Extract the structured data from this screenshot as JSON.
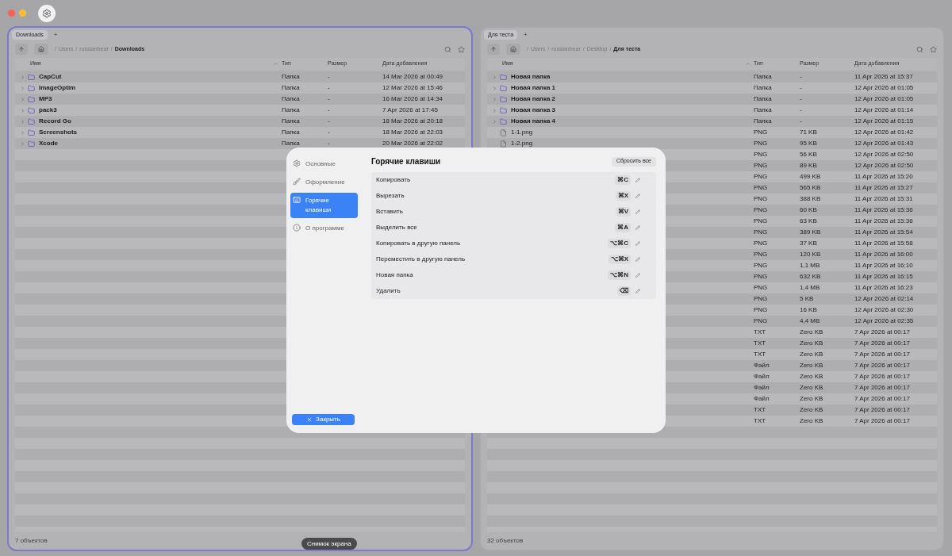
{
  "window": {
    "lights": [
      {
        "color": "#ff5f57"
      },
      {
        "color": "#febc2e"
      }
    ]
  },
  "panels": [
    {
      "active": true,
      "tabs": [
        {
          "label": "Downloads",
          "selected": true
        }
      ],
      "add_tab": "+",
      "separator": "/",
      "path": [
        "/",
        "Users",
        "russianbear",
        "Downloads"
      ],
      "columns": [
        "Имя",
        "Тип",
        "Размер",
        "Дата добавления"
      ],
      "rows": [
        {
          "kind": "folder",
          "name": "CapCut",
          "type": "Папка",
          "size": "-",
          "date": "14 Mar 2026 at 00:49"
        },
        {
          "kind": "folder",
          "name": "ImageOptim",
          "type": "Папка",
          "size": "-",
          "date": "12 Mar 2026 at 15:46"
        },
        {
          "kind": "folder",
          "name": "MP3",
          "type": "Папка",
          "size": "-",
          "date": "16 Mar 2026 at 14:34"
        },
        {
          "kind": "folder",
          "name": "pack3",
          "type": "Папка",
          "size": "-",
          "date": "7 Apr 2026 at 17:45"
        },
        {
          "kind": "folder",
          "name": "Record Go",
          "type": "Папка",
          "size": "-",
          "date": "18 Mar 2026 at 20:18"
        },
        {
          "kind": "folder",
          "name": "Screenshots",
          "type": "Папка",
          "size": "-",
          "date": "18 Mar 2026 at 22:03"
        },
        {
          "kind": "folder",
          "name": "Xcode",
          "type": "Папка",
          "size": "-",
          "date": "20 Mar 2026 at 22:02"
        }
      ],
      "status": "7 объектов"
    },
    {
      "active": false,
      "tabs": [
        {
          "label": "Для теста",
          "selected": true
        }
      ],
      "add_tab": "+",
      "separator": "/",
      "path": [
        "/",
        "Users",
        "russianbear",
        "Desktop",
        "Для теста"
      ],
      "columns": [
        "Имя",
        "Тип",
        "Размер",
        "Дата добавления"
      ],
      "rows": [
        {
          "kind": "folder",
          "name": "Новая папка",
          "type": "Папка",
          "size": "-",
          "date": "11 Apr 2026 at 15:37"
        },
        {
          "kind": "folder",
          "name": "Новая папка 1",
          "type": "Папка",
          "size": "-",
          "date": "12 Apr 2026 at 01:05"
        },
        {
          "kind": "folder",
          "name": "Новая папка 2",
          "type": "Папка",
          "size": "-",
          "date": "12 Apr 2026 at 01:05"
        },
        {
          "kind": "folder",
          "name": "Новая папка 3",
          "type": "Папка",
          "size": "-",
          "date": "12 Apr 2026 at 01:14"
        },
        {
          "kind": "folder",
          "name": "Новая папка 4",
          "type": "Папка",
          "size": "-",
          "date": "12 Apr 2026 at 01:15"
        },
        {
          "kind": "file",
          "name": "1-1.png",
          "type": "PNG",
          "size": "71 KB",
          "date": "12 Apr 2026 at 01:42"
        },
        {
          "kind": "file",
          "name": "1-2.png",
          "type": "PNG",
          "size": "95 KB",
          "date": "12 Apr 2026 at 01:43"
        },
        {
          "type": "PNG",
          "size": "56 KB",
          "date": "12 Apr 2026 at 02:50"
        },
        {
          "type": "PNG",
          "size": "89 KB",
          "date": "12 Apr 2026 at 02:50"
        },
        {
          "type": "PNG",
          "size": "499 KB",
          "date": "11 Apr 2026 at 15:20"
        },
        {
          "type": "PNG",
          "size": "565 KB",
          "date": "11 Apr 2026 at 15:27"
        },
        {
          "type": "PNG",
          "size": "388 KB",
          "date": "11 Apr 2026 at 15:31"
        },
        {
          "type": "PNG",
          "size": "60 KB",
          "date": "11 Apr 2026 at 15:36"
        },
        {
          "type": "PNG",
          "size": "63 KB",
          "date": "11 Apr 2026 at 15:36"
        },
        {
          "type": "PNG",
          "size": "389 KB",
          "date": "11 Apr 2026 at 15:54"
        },
        {
          "type": "PNG",
          "size": "37 KB",
          "date": "11 Apr 2026 at 15:58"
        },
        {
          "type": "PNG",
          "size": "120 KB",
          "date": "11 Apr 2026 at 16:00"
        },
        {
          "type": "PNG",
          "size": "1,1 MB",
          "date": "11 Apr 2026 at 16:10"
        },
        {
          "type": "PNG",
          "size": "632 KB",
          "date": "11 Apr 2026 at 16:15"
        },
        {
          "type": "PNG",
          "size": "1,4 MB",
          "date": "11 Apr 2026 at 16:23"
        },
        {
          "type": "PNG",
          "size": "5 KB",
          "date": "12 Apr 2026 at 02:14"
        },
        {
          "type": "PNG",
          "size": "16 KB",
          "date": "12 Apr 2026 at 02:30"
        },
        {
          "type": "PNG",
          "size": "4,4 MB",
          "date": "12 Apr 2026 at 02:35"
        },
        {
          "type": "TXT",
          "size": "Zero KB",
          "date": "7 Apr 2026 at 00:17"
        },
        {
          "type": "TXT",
          "size": "Zero KB",
          "date": "7 Apr 2026 at 00:17"
        },
        {
          "type": "TXT",
          "size": "Zero KB",
          "date": "7 Apr 2026 at 00:17"
        },
        {
          "type": "Файл",
          "size": "Zero KB",
          "date": "7 Apr 2026 at 00:17"
        },
        {
          "type": "Файл",
          "size": "Zero KB",
          "date": "7 Apr 2026 at 00:17"
        },
        {
          "type": "Файл",
          "size": "Zero KB",
          "date": "7 Apr 2026 at 00:17"
        },
        {
          "type": "Файл",
          "size": "Zero KB",
          "date": "7 Apr 2026 at 00:17"
        },
        {
          "type": "TXT",
          "size": "Zero KB",
          "date": "7 Apr 2026 at 00:17"
        },
        {
          "type": "TXT",
          "size": "Zero KB",
          "date": "7 Apr 2026 at 00:17"
        }
      ],
      "status": "32 объектов"
    }
  ],
  "dialog": {
    "nav": [
      {
        "kind": "general",
        "label": "Основные",
        "selected": false
      },
      {
        "kind": "appearance",
        "label": "Оформление",
        "selected": false
      },
      {
        "kind": "hotkeys",
        "label": "Горячие клавиши",
        "selected": true
      },
      {
        "kind": "about",
        "label": "О программе",
        "selected": false
      }
    ],
    "title": "Горячие клавиши",
    "reset_button": "Сбросить все",
    "shortcuts": [
      {
        "action": "Копировать",
        "keys": "⌘C"
      },
      {
        "action": "Вырезать",
        "keys": "⌘X"
      },
      {
        "action": "Вставить",
        "keys": "⌘V"
      },
      {
        "action": "Выделить все",
        "keys": "⌘A"
      },
      {
        "action": "Копировать в другую панель",
        "keys": "⌥⌘C"
      },
      {
        "action": "Переместить в другую панель",
        "keys": "⌥⌘X"
      },
      {
        "action": "Новая папка",
        "keys": "⌥⌘N"
      },
      {
        "action": "Удалить",
        "keys": "⌫"
      }
    ],
    "close_button": "Закрыть"
  },
  "tooltip": "Снимок экрана"
}
